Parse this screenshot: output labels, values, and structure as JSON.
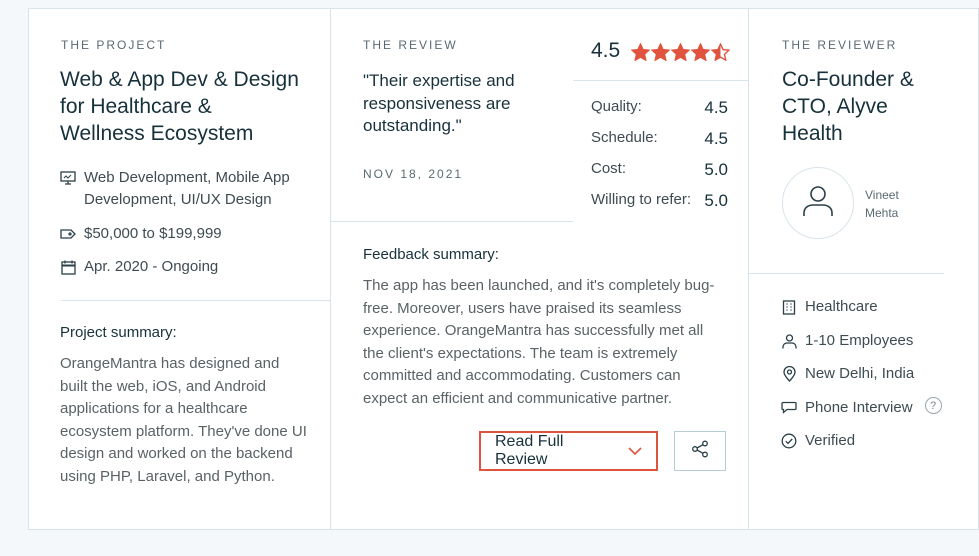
{
  "project": {
    "eyebrow": "THE PROJECT",
    "title_lines": [
      "Web & App Dev & Design",
      "for Healthcare &",
      "Wellness Ecosystem"
    ],
    "services": "Web Development, Mobile App Development, UI/UX Design",
    "budget": "$50,000 to $199,999",
    "timeline": "Apr. 2020 - Ongoing",
    "summary_label": "Project summary:",
    "summary": "OrangeMantra has designed and built the web, iOS, and Android applications for a healthcare ecosystem platform. They've done UI design and worked on the backend using PHP, Laravel, and Python."
  },
  "review": {
    "eyebrow": "THE REVIEW",
    "quote": "\"Their expertise and responsiveness are outstanding.\"",
    "date": "NOV 18, 2021",
    "feedback_label": "Feedback summary:",
    "feedback": "The app has been launched, and it's completely bug-free. Moreover, users have praised its seamless experience. OrangeMantra has successfully met all the client's expectations. The team is extremely committed and accommodating. Customers can expect an efficient and communicative partner.",
    "read_full_label": "Read Full Review"
  },
  "rating": {
    "overall": "4.5",
    "stars_value": 4.5,
    "stars_max": 5,
    "star_color": "#e0543f",
    "scores": [
      {
        "label": "Quality:",
        "value": "4.5"
      },
      {
        "label": "Schedule:",
        "value": "4.5"
      },
      {
        "label": "Cost:",
        "value": "5.0"
      },
      {
        "label": "Willing to refer:",
        "value": "5.0"
      }
    ]
  },
  "reviewer": {
    "eyebrow": "THE REVIEWER",
    "title_lines": [
      "Co-Founder &",
      "CTO, Alyve",
      "Health"
    ],
    "name_first": "Vineet",
    "name_last": "Mehta",
    "industry": "Healthcare",
    "size": "1-10 Employees",
    "location": "New Delhi, India",
    "interview": "Phone Interview",
    "help": "?",
    "verified": "Verified"
  },
  "colors": {
    "accent": "#e0543f",
    "text": "#17313b",
    "border": "#d9e4ea"
  }
}
